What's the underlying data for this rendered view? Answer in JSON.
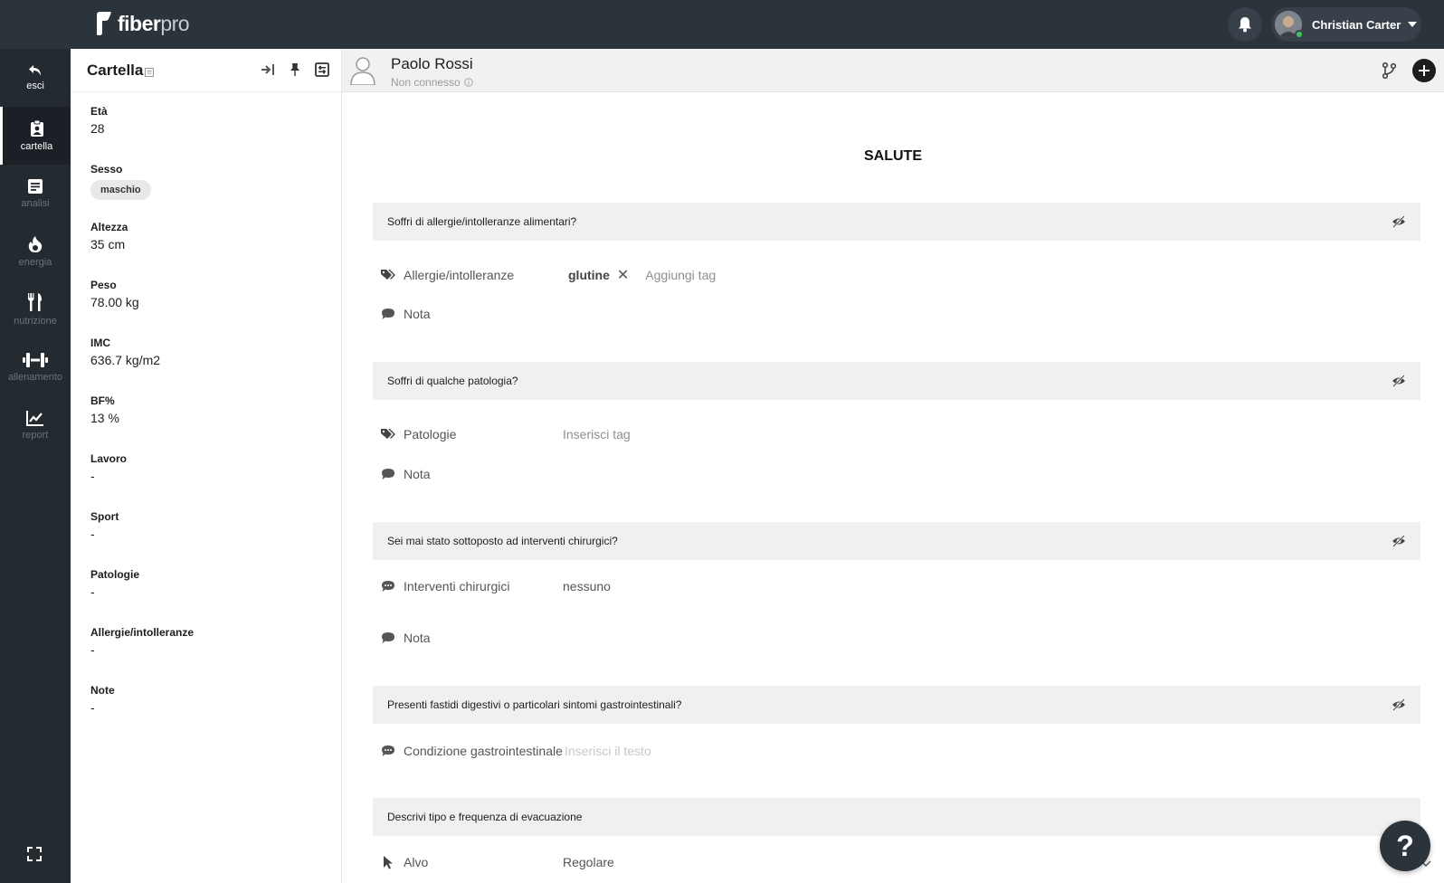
{
  "brand": {
    "name_a": "fiber",
    "name_b": "pro"
  },
  "user": {
    "name": "Christian Carter"
  },
  "rail": {
    "items": [
      {
        "label": "esci"
      },
      {
        "label": "cartella"
      },
      {
        "label": "analisi"
      },
      {
        "label": "energia"
      },
      {
        "label": "nutrizione"
      },
      {
        "label": "allenamento"
      },
      {
        "label": "report"
      }
    ]
  },
  "panel": {
    "title": "Cartella",
    "fields": [
      {
        "label": "Età",
        "value": "28"
      },
      {
        "label": "Sesso",
        "value": "maschio"
      },
      {
        "label": "Altezza",
        "value": "35 cm"
      },
      {
        "label": "Peso",
        "value": "78.00 kg"
      },
      {
        "label": "IMC",
        "value": "636.7 kg/m2"
      },
      {
        "label": "BF%",
        "value": "13 %"
      },
      {
        "label": "Lavoro",
        "value": "-"
      },
      {
        "label": "Sport",
        "value": "-"
      },
      {
        "label": "Patologie",
        "value": "-"
      },
      {
        "label": "Allergie/intolleranze",
        "value": "-"
      },
      {
        "label": "Note",
        "value": "-"
      }
    ]
  },
  "patient": {
    "name": "Paolo Rossi",
    "status": "Non connesso"
  },
  "main": {
    "section_title": "SALUTE",
    "questions": [
      {
        "title": "Soffri di allergie/intolleranze alimentari?",
        "field_label": "Allergie/intolleranze",
        "tag": "glutine",
        "add_placeholder": "Aggiungi tag",
        "note_label": "Nota"
      },
      {
        "title": "Soffri di qualche patologia?",
        "field_label": "Patologie",
        "add_placeholder": "Inserisci tag",
        "note_label": "Nota"
      },
      {
        "title": "Sei mai stato sottoposto ad interventi chirurgici?",
        "field_label": "Interventi chirurgici",
        "value": "nessuno",
        "note_label": "Nota"
      },
      {
        "title": "Presenti fastidi digestivi o particolari sintomi gastrointestinali?",
        "field_label": "Condizione gastrointestinale",
        "placeholder": "Inserisci il testo"
      },
      {
        "title": "Descrivi tipo e frequenza di evacuazione",
        "field_label": "Alvo",
        "value": "Regolare"
      }
    ]
  },
  "help": {
    "label": "?"
  }
}
